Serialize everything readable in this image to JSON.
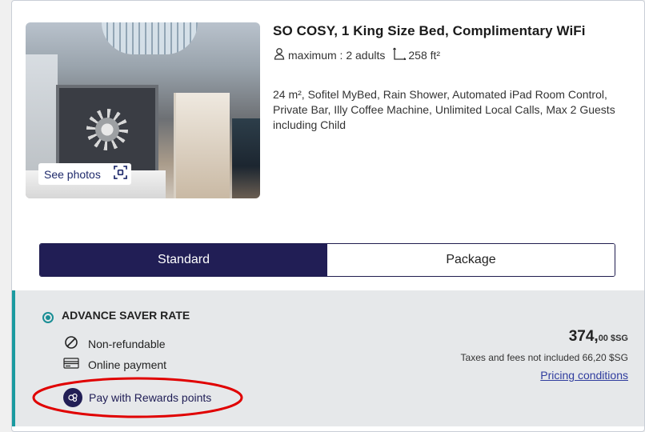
{
  "room": {
    "title": "SO COSY, 1 King Size Bed, Complimentary WiFi",
    "occupancy": "maximum : 2 adults",
    "area": "258 ft²",
    "description": "24 m², Sofitel MyBed, Rain Shower, Automated iPad Room Control, Private Bar, Illy Coffee Machine, Unlimited Local Calls, Max 2 Guests including Child",
    "see_photos": "See photos",
    "icons": {
      "occupancy": "person-icon",
      "area": "area-icon",
      "photos": "expand-icon"
    }
  },
  "tabs": [
    {
      "label": "Standard",
      "active": true
    },
    {
      "label": "Package",
      "active": false
    }
  ],
  "rate": {
    "name": "ADVANCE SAVER RATE",
    "selected": true,
    "conditions": [
      {
        "icon": "no-refund-icon",
        "label": "Non-refundable"
      },
      {
        "icon": "credit-card-icon",
        "label": "Online payment"
      }
    ],
    "rewards_label": "Pay with Rewards points",
    "price_main": "374,",
    "price_decimals": "00 $SG",
    "taxes": "Taxes and fees not included 66,20 $SG",
    "pricing_link": "Pricing conditions"
  },
  "colors": {
    "navy": "#211e55",
    "teal": "#1a9aa0",
    "link": "#2f3c9e",
    "highlight": "#e00000",
    "panel": "#e6e8ea"
  }
}
